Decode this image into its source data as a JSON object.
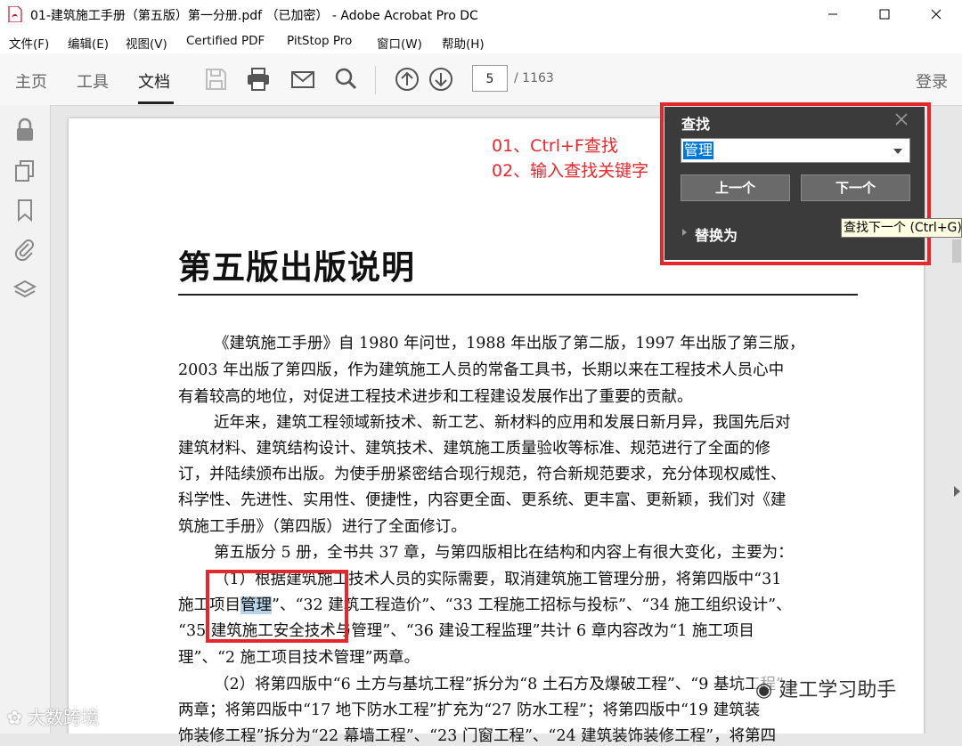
{
  "window": {
    "title": "01-建筑施工手册（第五版）第一分册.pdf （已加密） - Adobe Acrobat Pro DC"
  },
  "menu": [
    "文件(F)",
    "编辑(E)",
    "视图(V)",
    "Certified PDF",
    "PitStop Pro",
    "窗口(W)",
    "帮助(H)"
  ],
  "toolbar": {
    "tabs": [
      "主页",
      "工具",
      "文档"
    ],
    "active_tab": "文档",
    "page_current": "5",
    "page_total": "/ 1163",
    "login": "登录",
    "icons": [
      "save-icon",
      "print-icon",
      "email-icon",
      "search-icon",
      "prev-page-icon",
      "next-page-icon"
    ]
  },
  "left_panel_icons": [
    "lock-icon",
    "pages-icon",
    "bookmark-icon",
    "attachment-icon",
    "layers-icon"
  ],
  "annotations": {
    "step1": "01、Ctrl+F查找",
    "step2": "02、输入查找关键字"
  },
  "find_panel": {
    "title": "查找",
    "query": "管理",
    "prev_label": "上一个",
    "next_label": "下一个",
    "replace_label": "替换为",
    "tooltip": "查找下一个 (Ctrl+G)"
  },
  "document": {
    "heading": "第五版出版说明",
    "lines": {
      "l1": "《建筑施工手册》自 1980 年问世，1988 年出版了第二版，1997 年出版了第三版，",
      "l2": "2003 年出版了第四版，作为建筑施工人员的常备工具书，长期以来在工程技术人员心中",
      "l3": "有着较高的地位，对促进工程技术进步和工程建设发展作出了重要的贡献。",
      "l4": "近年来，建筑工程领域新技术、新工艺、新材料的应用和发展日新月异，我国先后对",
      "l5": "建筑材料、建筑结构设计、建筑技术、建筑施工质量验收等标准、规范进行了全面的修",
      "l6": "订，并陆续颁布出版。为使手册紧密结合现行规范，符合新规范要求，充分体现权威性、",
      "l7": "科学性、先进性、实用性、便捷性，内容更全面、更系统、更丰富、更新颖，我们对《建",
      "l8": "筑施工手册》（第四版）进行了全面修订。",
      "l9": "第五版分 5 册，全书共 37 章，与第四版相比在结构和内容上有很大变化，主要为：",
      "l10": "（1）根据建筑施工技术人员的实际需要，取消建筑施工管理分册，将第四版中“31",
      "l11a": "施工项目",
      "l11hl": "管理",
      "l11b": "”、“32 建筑工程造价”、“33 工程施工招标与投标”、“34 施工组织设计”、",
      "l12": "“35 建筑施工安全技术与管理”、“36 建设工程监理”共计 6 章内容改为“1 施工项目",
      "l13": "理”、“2 施工项目技术管理”两章。",
      "l14": "（2）将第四版中“6 土方与基坑工程”拆分为“8 土石方及爆破工程”、“9 基坑工程”",
      "l15": "两章；将第四版中“17 地下防水工程”扩充为“27 防水工程”；将第四版中“19 建筑装",
      "l16": "饰装修工程”拆分为“22 幕墙工程”、“23 门窗工程”、“24 建筑装饰装修工程”，将第四"
    }
  },
  "watermarks": {
    "corner_logo": "大数跨境",
    "wechat": "建工学习助手"
  },
  "colors": {
    "annotation_red": "#e8262b",
    "find_panel_bg": "#3b3b3b",
    "selection_blue": "#0078d7",
    "highlight": "#b7d3ea"
  }
}
